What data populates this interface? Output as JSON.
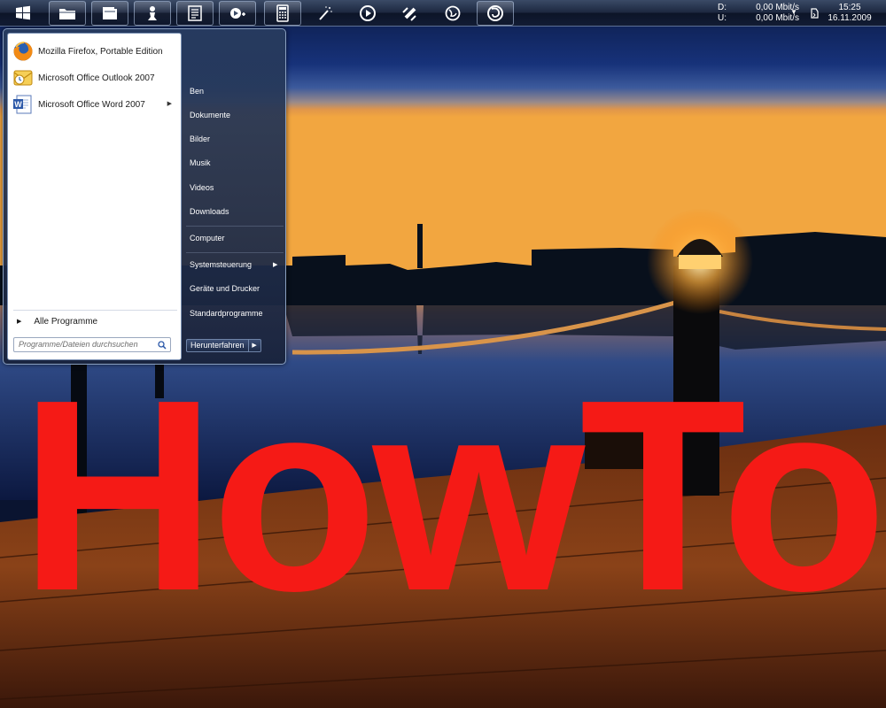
{
  "taskbar": {
    "buttons": [
      {
        "name": "start-orb-icon"
      },
      {
        "name": "explorer-folder-icon"
      },
      {
        "name": "documents-folder-icon"
      },
      {
        "name": "user-chess-icon"
      },
      {
        "name": "word-document-icon"
      },
      {
        "name": "media-player-icon"
      },
      {
        "name": "calculator-icon"
      },
      {
        "name": "magic-wand-icon"
      },
      {
        "name": "play-circle-icon"
      },
      {
        "name": "satellite-icon"
      },
      {
        "name": "globe-icon"
      },
      {
        "name": "firefox-icon"
      }
    ],
    "network": {
      "down_label": "D:",
      "down_value": "0,00 Mbit/s",
      "up_label": "U:",
      "up_value": "0,00 Mbit/s"
    },
    "clock": {
      "time": "15:25",
      "date": "16.11.2009"
    }
  },
  "start_menu": {
    "pinned_programs": [
      {
        "label": "Mozilla Firefox, Portable Edition",
        "icon": "firefox-icon",
        "submenu": false
      },
      {
        "label": "Microsoft Office Outlook 2007",
        "icon": "outlook-icon",
        "submenu": false
      },
      {
        "label": "Microsoft Office Word 2007",
        "icon": "word-icon",
        "submenu": true
      }
    ],
    "all_programs_label": "Alle Programme",
    "search_placeholder": "Programme/Dateien durchsuchen",
    "right_items": [
      {
        "label": "Ben",
        "submenu": false
      },
      {
        "label": "Dokumente",
        "submenu": false
      },
      {
        "label": "Bilder",
        "submenu": false
      },
      {
        "label": "Musik",
        "submenu": false
      },
      {
        "label": "Videos",
        "submenu": false
      },
      {
        "label": "Downloads",
        "submenu": false
      },
      {
        "label": "Computer",
        "submenu": false
      },
      {
        "label": "Systemsteuerung",
        "submenu": true
      },
      {
        "label": "Geräte und Drucker",
        "submenu": false
      },
      {
        "label": "Standardprogramme",
        "submenu": false
      }
    ],
    "shutdown_label": "Herunterfahren"
  },
  "overlay_text": "HowTo",
  "colors": {
    "overlay_red": "#f51a16",
    "taskbar_dark": "#0c1428",
    "sky_top": "#0f1f4a",
    "sunset_orange": "#d9822b",
    "dock_wood": "#7a3a14"
  }
}
